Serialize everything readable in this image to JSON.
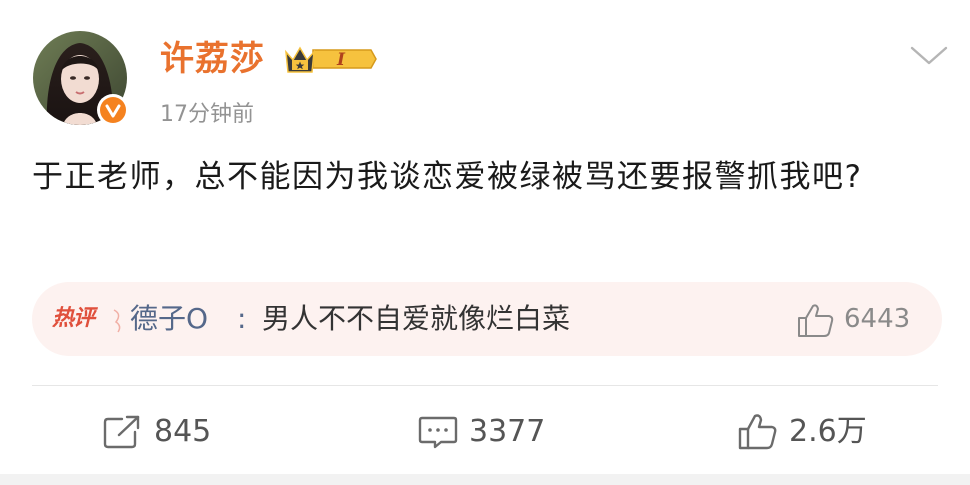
{
  "post": {
    "author": {
      "name": "许荔莎",
      "badge_level": "I",
      "verified": true
    },
    "time": "17分钟前",
    "text": "于正老师，总不能因为我谈恋爱被绿被骂还要报警抓我吧?"
  },
  "hot_comment": {
    "tag": "热评",
    "author": "德子O",
    "colon": ":",
    "text": "男人不不自爱就像烂白菜",
    "likes": "6443"
  },
  "actions": {
    "repost_count": "845",
    "comment_count": "3377",
    "like_count": "2.6万"
  },
  "colors": {
    "name": "#e9722e",
    "hot_tag": "#e0503c",
    "comment_author": "#55688a",
    "hot_bg": "#fdf2f0",
    "verified": "#f5821f"
  },
  "icons": {
    "more": "chevron-down-icon",
    "verified": "verified-badge-icon",
    "vip": "crown-badge-icon",
    "repost": "repost-icon",
    "comment": "comment-icon",
    "like": "thumbs-up-icon"
  }
}
